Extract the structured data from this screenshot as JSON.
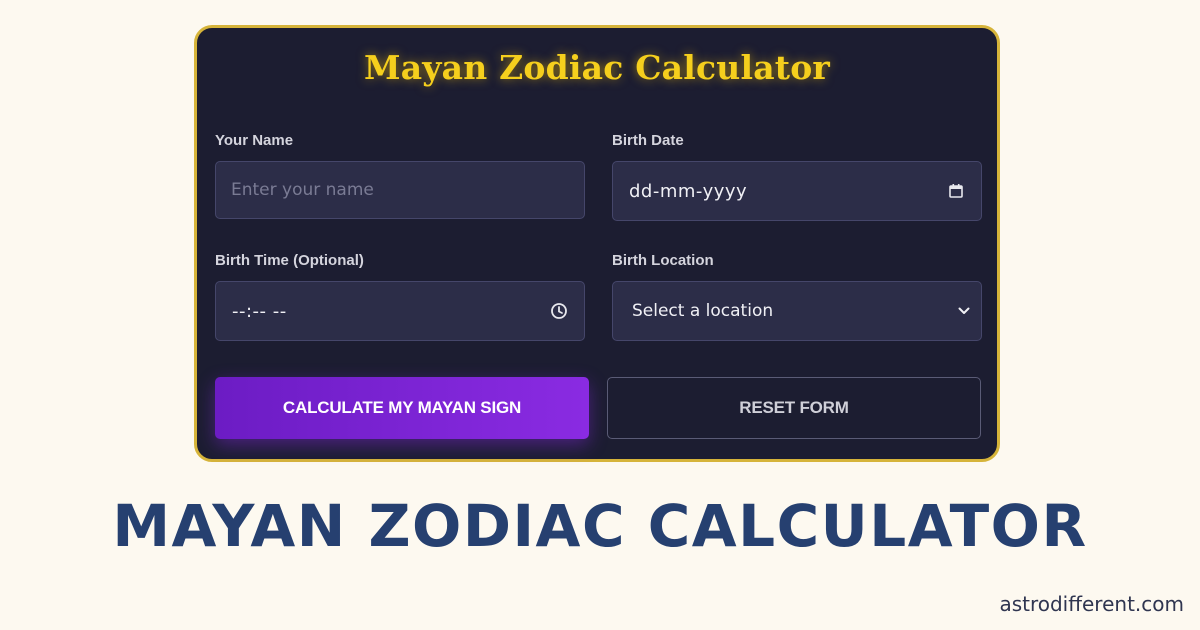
{
  "card": {
    "title": "Mayan Zodiac Calculator",
    "fields": {
      "name": {
        "label": "Your Name",
        "placeholder": "Enter your name"
      },
      "birth_date": {
        "label": "Birth Date",
        "value": "dd-mm-yyyy",
        "icon": "calendar-icon"
      },
      "birth_time": {
        "label": "Birth Time (Optional)",
        "value": "--:-- --",
        "icon": "clock-icon"
      },
      "birth_location": {
        "label": "Birth Location",
        "selected": "Select a location",
        "icon": "chevron-down-icon"
      }
    },
    "buttons": {
      "calculate": "CALCULATE MY MAYAN SIGN",
      "reset": "RESET FORM"
    }
  },
  "banner": {
    "title": "MAYAN ZODIAC CALCULATOR",
    "site": "astrodifferent.com"
  },
  "colors": {
    "page_background": "#fdf9f0",
    "card_background": "#1c1d31",
    "card_border": "#d6b43a",
    "title_gold": "#f5cf1d",
    "field_background": "#2c2d48",
    "primary_button": "#8a2be2",
    "banner_title": "#264070"
  }
}
